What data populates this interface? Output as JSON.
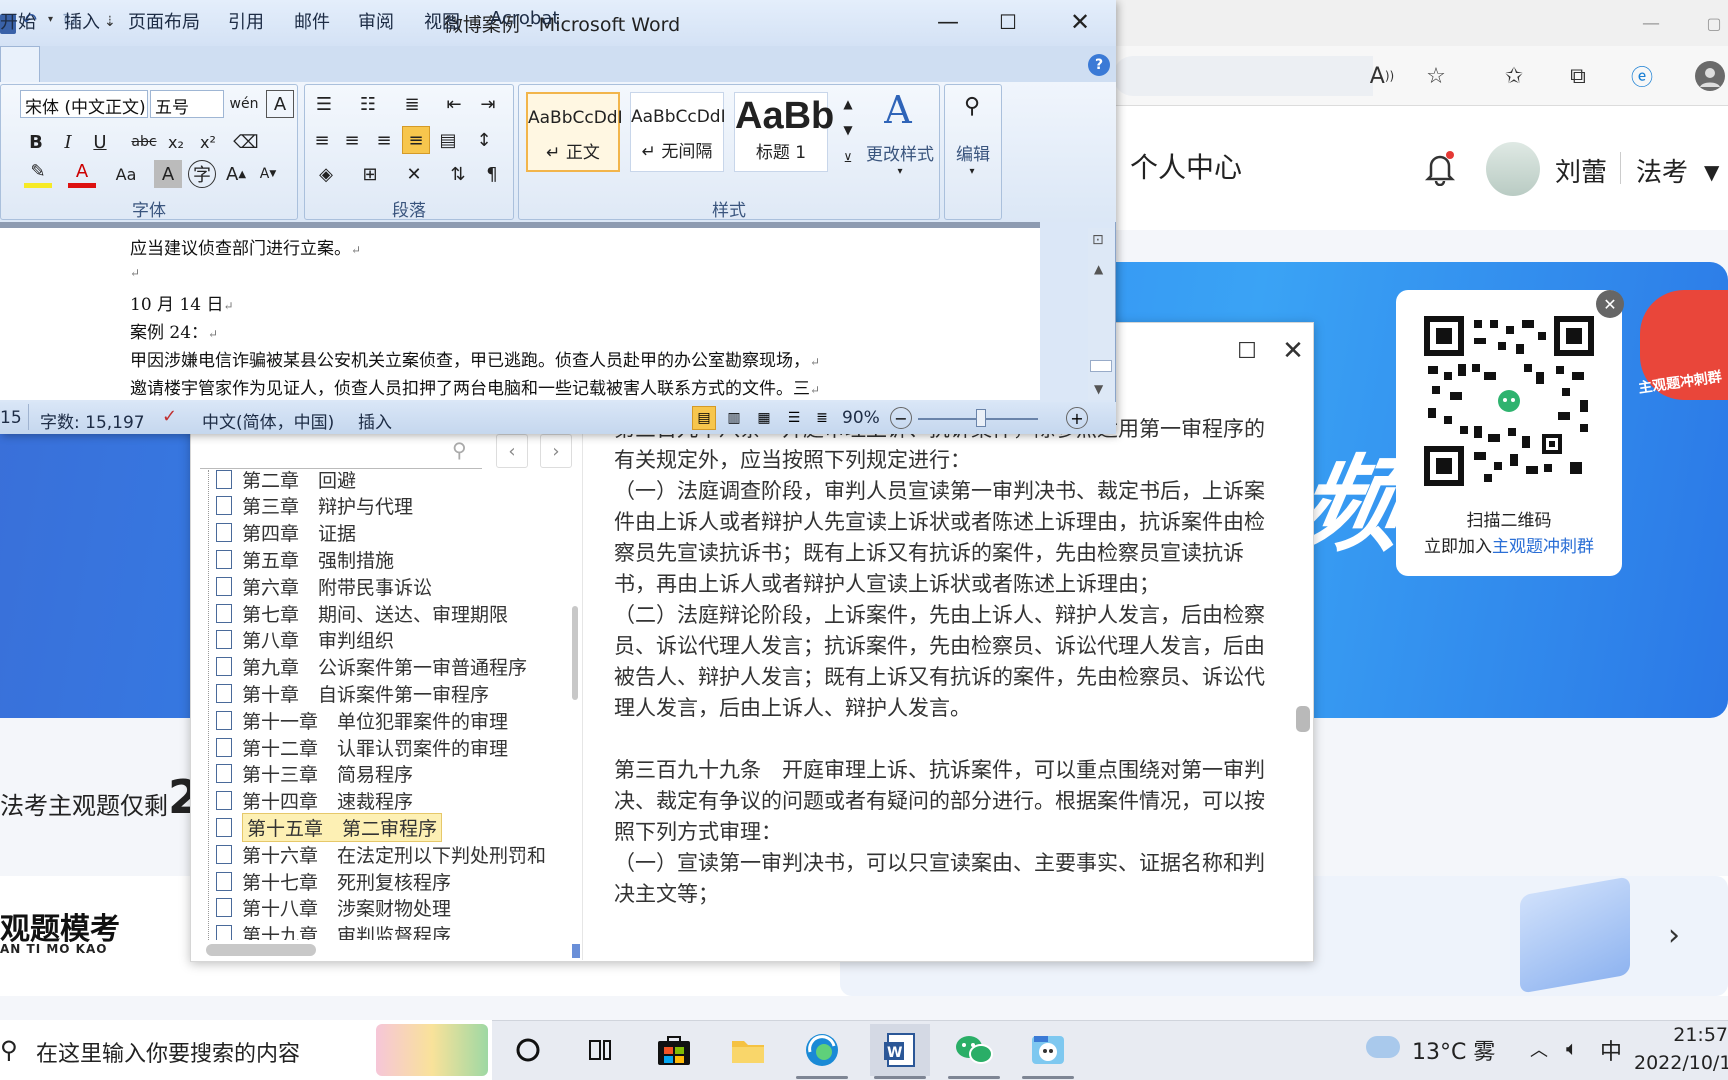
{
  "browser": {
    "header": {
      "center_label": "个人中心",
      "user_name": "刘蕾",
      "exam_menu": "法考"
    },
    "banner": {
      "big_char": "频",
      "badge_text": "主观题冲刺群",
      "qr_close": "✕",
      "qr_line1": "扫描二维码",
      "qr_line2_prefix": "立即加入",
      "qr_line2_link": "主观题冲刺群"
    },
    "section": {
      "countdown_label": "法考主观题仅剩",
      "countdown_num": "2",
      "mock_title": "观题模考",
      "mock_subtitle": "AN TI MO KAO"
    }
  },
  "reader": {
    "toc": [
      {
        "label": "第二章　回避",
        "active": false
      },
      {
        "label": "第三章　辩护与代理",
        "active": false
      },
      {
        "label": "第四章　证据",
        "active": false
      },
      {
        "label": "第五章　强制措施",
        "active": false
      },
      {
        "label": "第六章　附带民事诉讼",
        "active": false
      },
      {
        "label": "第七章　期间、送达、审理期限",
        "active": false
      },
      {
        "label": "第八章　审判组织",
        "active": false
      },
      {
        "label": "第九章　公诉案件第一审普通程序",
        "active": false
      },
      {
        "label": "第十章　自诉案件第一审程序",
        "active": false
      },
      {
        "label": "第十一章　单位犯罪案件的审理",
        "active": false
      },
      {
        "label": "第十二章　认罪认罚案件的审理",
        "active": false
      },
      {
        "label": "第十三章　简易程序",
        "active": false
      },
      {
        "label": "第十四章　速裁程序",
        "active": false
      },
      {
        "label": "第十五章　第二审程序",
        "active": true
      },
      {
        "label": "第十六章　在法定刑以下判处刑罚和",
        "active": false
      },
      {
        "label": "第十七章　死刑复核程序",
        "active": false
      },
      {
        "label": "第十八章　涉案财物处理",
        "active": false
      },
      {
        "label": "第十九章　审判监督程序",
        "active": false
      }
    ],
    "body": [
      "第三百九十八条　开庭审理上诉、抗诉案件，除参照适用第一审程序的有关规定外，应当按照下列规定进行：",
      "（一）法庭调查阶段，审判人员宣读第一审判决书、裁定书后，上诉案件由上诉人或者辩护人先宣读上诉状或者陈述上诉理由，抗诉案件由检察员先宣读抗诉书；既有上诉又有抗诉的案件，先由检察员宣读抗诉书，再由上诉人或者辩护人宣读上诉状或者陈述上诉理由；",
      "（二）法庭辩论阶段，上诉案件，先由上诉人、辩护人发言，后由检察员、诉讼代理人发言；抗诉案件，先由检察员、诉讼代理人发言，后由被告人、辩护人发言；既有上诉又有抗诉的案件，先由检察员、诉讼代理人发言，后由上诉人、辩护人发言。",
      "",
      "第三百九十九条　开庭审理上诉、抗诉案件，可以重点围绕对第一审判决、裁定有争议的问题或者有疑问的部分进行。根据案件情况，可以按照下列方式审理：",
      "（一）宣读第一审判决书，可以只宣读案由、主要事实、证据名称和判决主文等；"
    ]
  },
  "word": {
    "title": "微博案例 - Microsoft Word",
    "tabs": [
      "开始",
      "插入",
      "页面布局",
      "引用",
      "邮件",
      "审阅",
      "视图",
      "Acrobat"
    ],
    "font_name": "宋体 (中文正文)",
    "font_size": "五号",
    "group_font": "字体",
    "group_paragraph": "段落",
    "group_styles": "样式",
    "styles": [
      {
        "sample": "AaBbCcDdI",
        "name": "↵ 正文"
      },
      {
        "sample": "AaBbCcDdI",
        "name": "↵ 无间隔"
      },
      {
        "sample": "AaBb",
        "name": "标题 1"
      }
    ],
    "change_styles": "更改样式",
    "edit": "编辑",
    "doc_lines": [
      "应当建议侦查部门进行立案。",
      "",
      "10 月 14 日",
      "案例 24：",
      "甲因涉嫌电信诈骗被某县公安机关立案侦查，甲已逃跑。侦查人员赴甲的办公室勘察现场，",
      "邀请楼宇管家作为见证人，侦查人员扣押了两台电脑和一些记载被害人联系方式的文件。三"
    ],
    "status": {
      "page": "15",
      "word_count": "字数: 15,197",
      "language": "中文(简体，中国)",
      "mode": "插入",
      "zoom": "90%"
    }
  },
  "taskbar": {
    "search_placeholder": "在这里输入你要搜索的内容",
    "weather": "13°C 雾",
    "ime": "中",
    "time": "21:57",
    "date": "2022/10/1"
  }
}
